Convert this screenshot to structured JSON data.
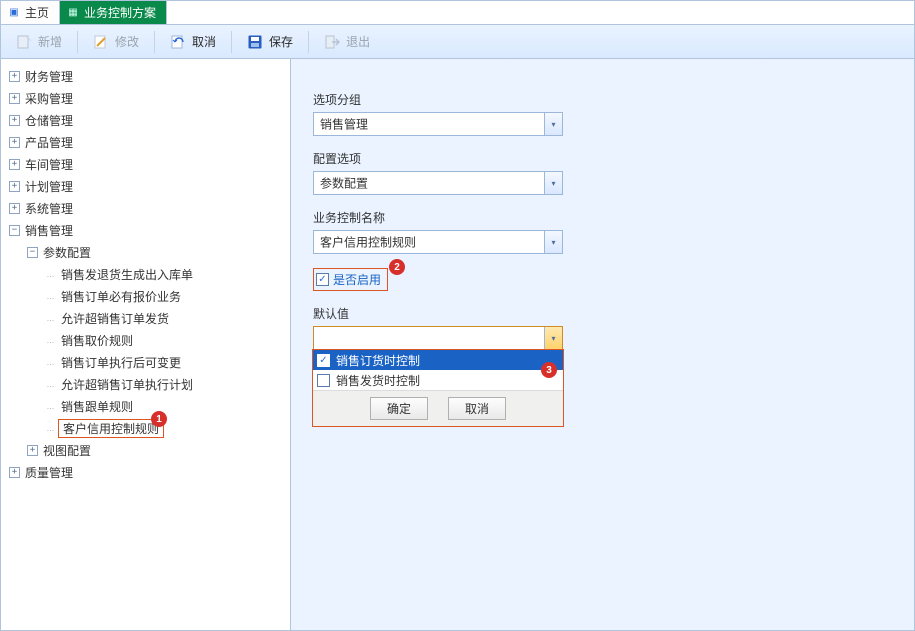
{
  "tabs": [
    {
      "label": "主页",
      "active": false
    },
    {
      "label": "业务控制方案",
      "active": true
    }
  ],
  "toolbar": {
    "new": "新增",
    "edit": "修改",
    "cancel": "取消",
    "save": "保存",
    "exit": "退出"
  },
  "tree": {
    "roots": [
      {
        "label": "财务管理",
        "expanded": false
      },
      {
        "label": "采购管理",
        "expanded": false
      },
      {
        "label": "仓储管理",
        "expanded": false
      },
      {
        "label": "产品管理",
        "expanded": false
      },
      {
        "label": "车间管理",
        "expanded": false
      },
      {
        "label": "计划管理",
        "expanded": false
      },
      {
        "label": "系统管理",
        "expanded": false
      },
      {
        "label": "销售管理",
        "expanded": true,
        "children": [
          {
            "label": "参数配置",
            "expanded": true,
            "children": [
              {
                "label": "销售发退货生成出入库单"
              },
              {
                "label": "销售订单必有报价业务"
              },
              {
                "label": "允许超销售订单发货"
              },
              {
                "label": "销售取价规则"
              },
              {
                "label": "销售订单执行后可变更"
              },
              {
                "label": "允许超销售订单执行计划"
              },
              {
                "label": "销售跟单规则"
              },
              {
                "label": "客户信用控制规则",
                "selected": true
              }
            ]
          },
          {
            "label": "视图配置",
            "expanded": false
          }
        ]
      },
      {
        "label": "质量管理",
        "expanded": false
      }
    ]
  },
  "callouts": {
    "c1": "1",
    "c2": "2",
    "c3": "3"
  },
  "form": {
    "group_label": "选项分组",
    "group_value": "销售管理",
    "option_label": "配置选项",
    "option_value": "参数配置",
    "ctrl_label": "业务控制名称",
    "ctrl_value": "客户信用控制规则",
    "enable_label": "是否启用",
    "enable_checked": true,
    "default_label": "默认值",
    "default_value": "",
    "dd_items": [
      {
        "label": "销售订货时控制",
        "checked": true,
        "selected": true
      },
      {
        "label": "销售发货时控制",
        "checked": false,
        "selected": false
      }
    ],
    "ok": "确定",
    "cancel": "取消"
  }
}
